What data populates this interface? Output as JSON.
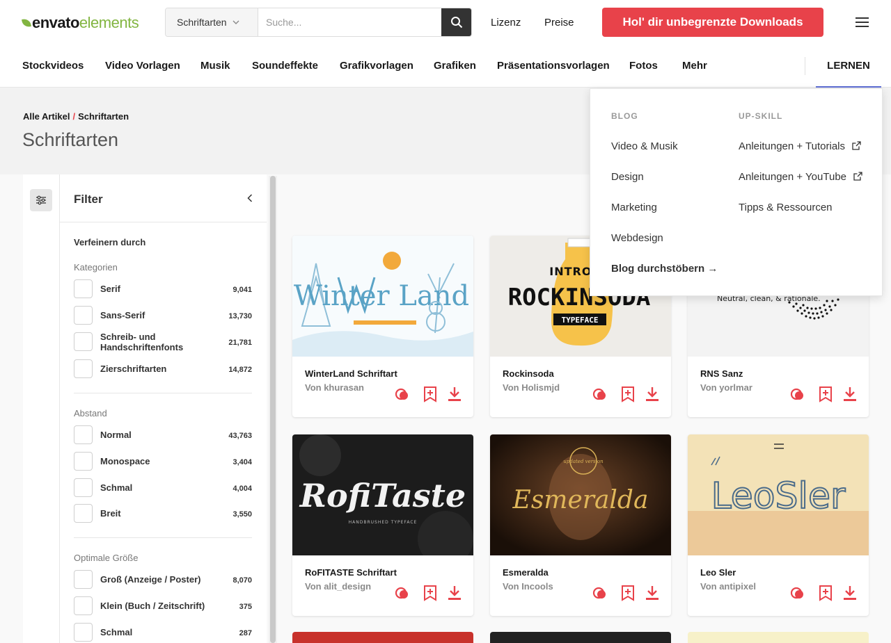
{
  "brand": {
    "word1": "envato",
    "word2": "elements",
    "accent": "#82b541"
  },
  "search": {
    "category": "Schriftarten",
    "placeholder": "Suche..."
  },
  "header_links": {
    "license": "Lizenz",
    "pricing": "Preise",
    "cta": "Hol' dir unbegrenzte Downloads",
    "cta_color": "#e8424a"
  },
  "nav": {
    "items": [
      "Stockvideos",
      "Video Vorlagen",
      "Musik",
      "Soundeffekte",
      "Grafikvorlagen",
      "Grafiken",
      "Präsentationsvorlagen",
      "Fotos",
      "Mehr"
    ],
    "learn": "LERNEN"
  },
  "breadcrumb": {
    "root": "Alle Artikel",
    "sep": "/",
    "current": "Schriftarten"
  },
  "page_title": "Schriftarten",
  "filter": {
    "title": "Filter",
    "refine": "Verfeinern durch",
    "categories_label": "Kategorien",
    "categories": [
      {
        "label": "Serif",
        "count": "9,041"
      },
      {
        "label": "Sans-Serif",
        "count": "13,730"
      },
      {
        "label": "Schreib- und Handschriftenfonts",
        "count": "21,781"
      },
      {
        "label": "Zierschriftarten",
        "count": "14,872"
      }
    ],
    "spacing_label": "Abstand",
    "spacing": [
      {
        "label": "Normal",
        "count": "43,763"
      },
      {
        "label": "Monospace",
        "count": "3,404"
      },
      {
        "label": "Schmal",
        "count": "4,004"
      },
      {
        "label": "Breit",
        "count": "3,550"
      }
    ],
    "size_label": "Optimale Größe",
    "size": [
      {
        "label": "Groß (Anzeige / Poster)",
        "count": "8,070"
      },
      {
        "label": "Klein (Buch / Zeitschrift)",
        "count": "375"
      },
      {
        "label": "Schmal",
        "count": "287"
      }
    ]
  },
  "cards": [
    {
      "title": "WinterLand Schriftart",
      "author": "Von khurasan",
      "art": "Winter Land"
    },
    {
      "title": "Rockinsoda",
      "author": "Von Holismjd",
      "art": "ROCKINSODA",
      "art_top": "INTRODU",
      "art_sub": "TYPEFACE"
    },
    {
      "title": "RNS Sanz",
      "author": "Von yorlmar",
      "art": "Neutral, clean, & rationale."
    },
    {
      "title": "RoFITASTE Schriftart",
      "author": "Von alit_design",
      "art": "RofiTaste",
      "art_sub": "HANDBRUSHED TYPEFACE"
    },
    {
      "title": "Esmeralda",
      "author": "Von Incools",
      "art": "Esmeralda",
      "art_top": "updated version"
    },
    {
      "title": "Leo Sler",
      "author": "Von antipixel",
      "art": "LeoSler"
    }
  ],
  "dropdown": {
    "blog_label": "BLOG",
    "upskill_label": "UP-SKILL",
    "blog": [
      "Video & Musik",
      "Design",
      "Marketing",
      "Webdesign"
    ],
    "blog_more": "Blog durchstöbern →",
    "upskill": [
      "Anleitungen + Tutorials",
      "Anleitungen + YouTube",
      "Tipps & Ressourcen"
    ]
  },
  "icons": {
    "action_1": "similar-icon",
    "action_2": "bookmark-add-icon",
    "action_3": "download-icon",
    "action_color": "#e8424a"
  }
}
